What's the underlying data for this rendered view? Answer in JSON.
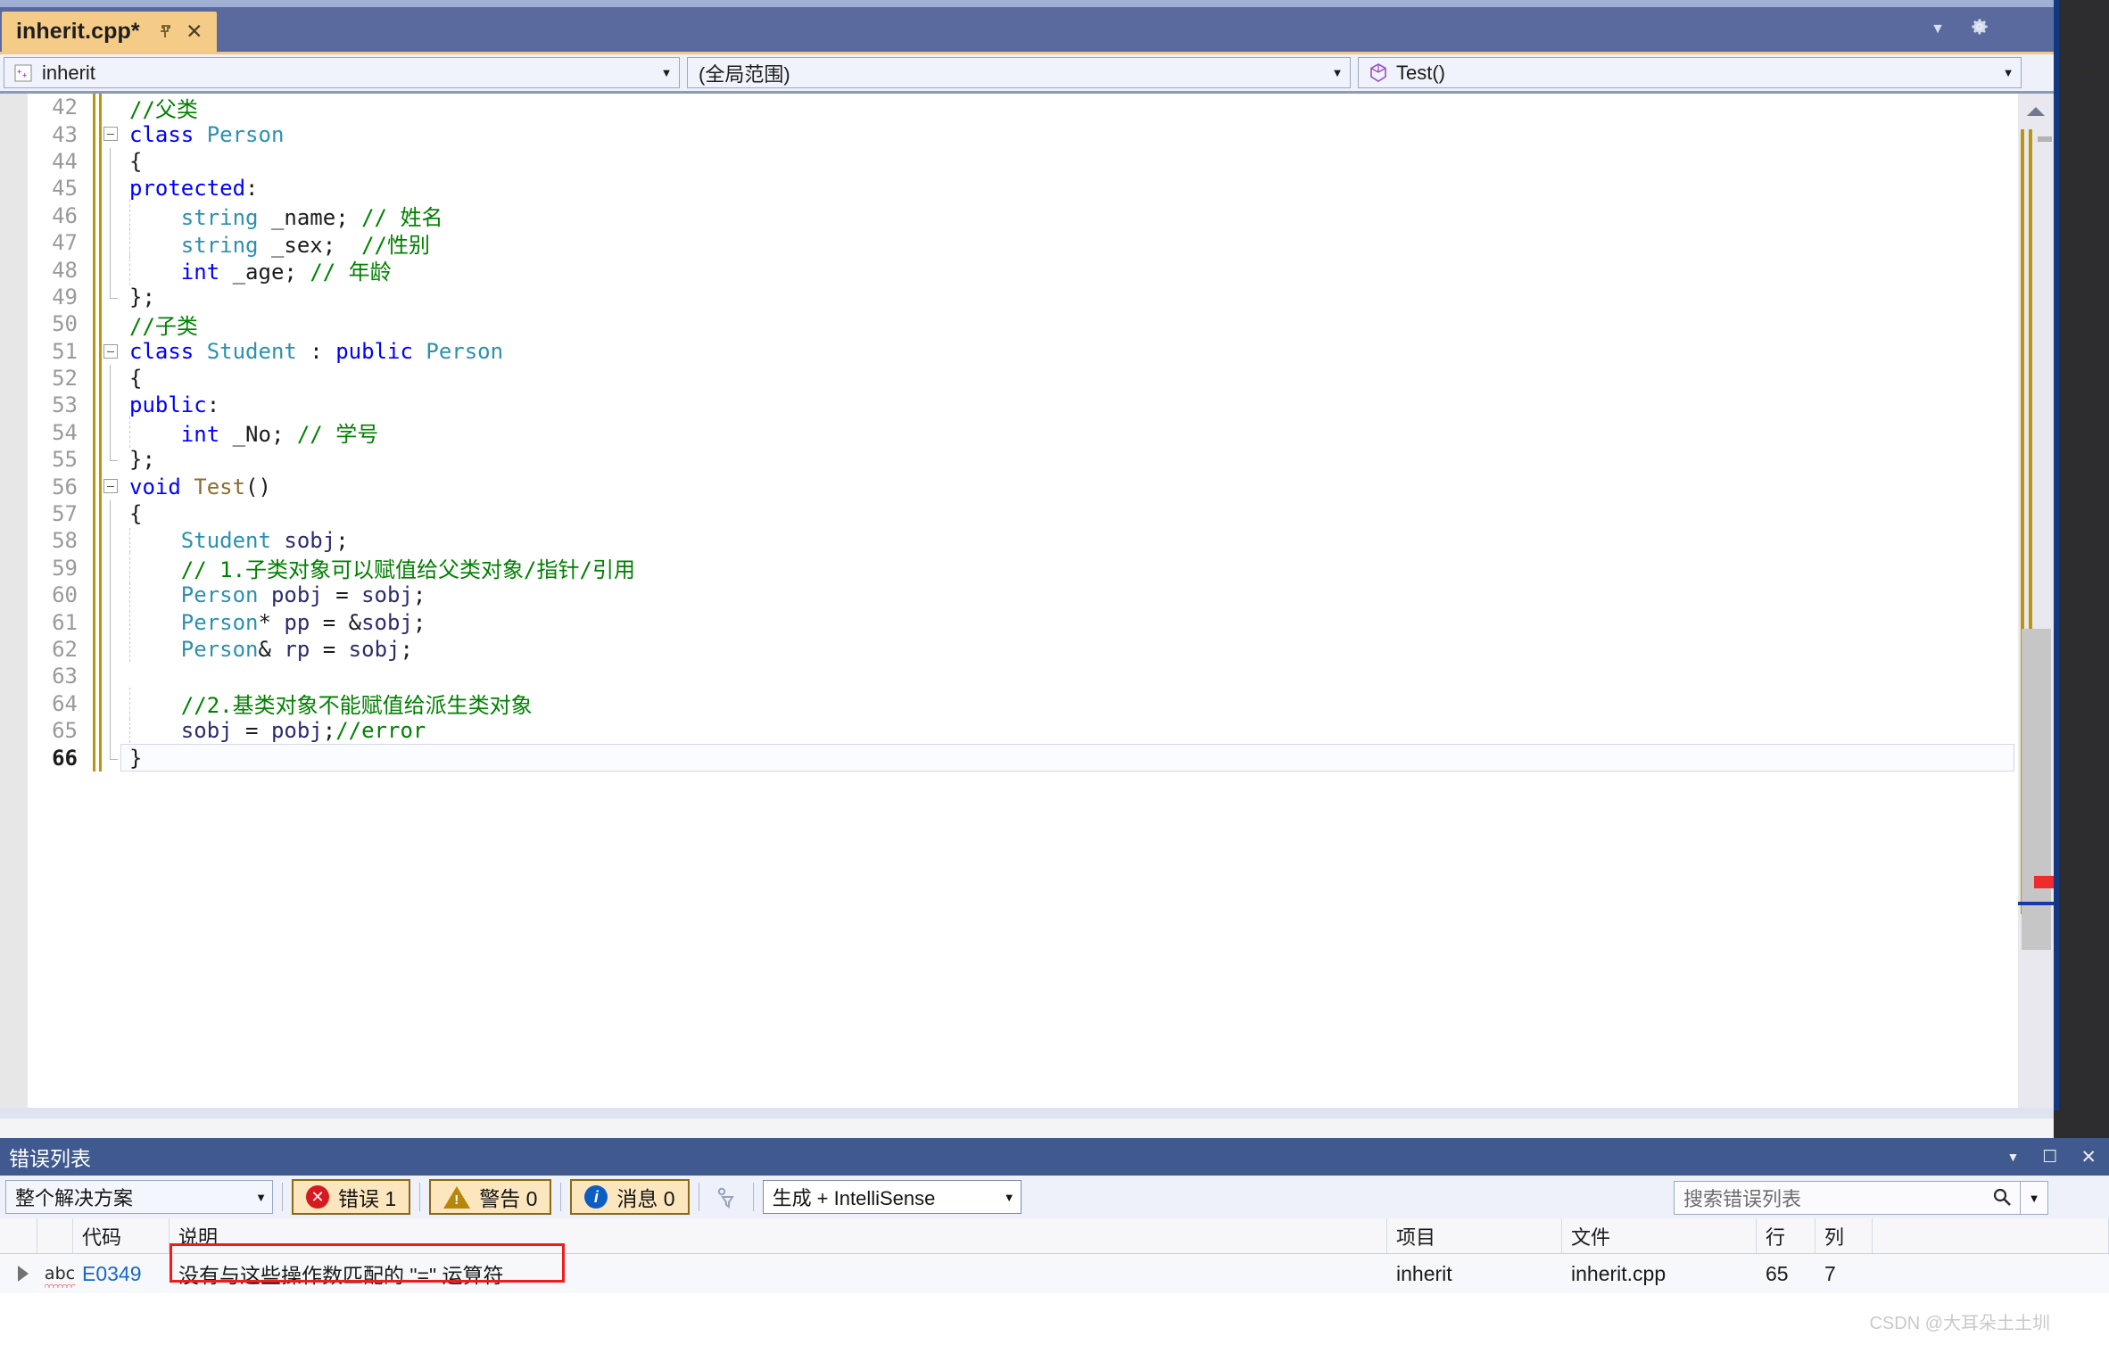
{
  "window": {
    "tab": {
      "label": "inherit.cpp*",
      "pin_icon": "pin-icon",
      "close_icon": "close-icon"
    },
    "tabbar_right": {
      "chevron_icon": "chevron-down-icon",
      "settings_icon": "gear-icon"
    }
  },
  "navbar": {
    "class_combo": {
      "icon": "cpp-file-icon",
      "value": "inherit",
      "caret": "▼"
    },
    "scope_combo": {
      "value": "(全局范围)",
      "caret": "▼"
    },
    "member_combo": {
      "icon": "method-cube-icon",
      "value": "Test()",
      "caret": "▼"
    },
    "split_icon": "split-window-icon"
  },
  "editor": {
    "first_visible_line": 42,
    "current_line": 66,
    "lines": [
      {
        "n": 42,
        "tokens": [
          {
            "t": "//父类",
            "c": "t-cmt"
          }
        ]
      },
      {
        "n": 43,
        "fold": "open",
        "tokens": [
          {
            "t": "class ",
            "c": "t-key"
          },
          {
            "t": "Person",
            "c": "t-type"
          }
        ]
      },
      {
        "n": 44,
        "tokens": [
          {
            "t": "{",
            "c": "t-pln"
          }
        ]
      },
      {
        "n": 45,
        "tokens": [
          {
            "t": "protected",
            "c": "t-key"
          },
          {
            "t": ":",
            "c": "t-pln"
          }
        ]
      },
      {
        "n": 46,
        "tokens": [
          {
            "t": "    ",
            "c": "t-pln"
          },
          {
            "t": "string",
            "c": "t-type"
          },
          {
            "t": " _name; ",
            "c": "t-pln"
          },
          {
            "t": "// 姓名",
            "c": "t-cmt"
          }
        ]
      },
      {
        "n": 47,
        "tokens": [
          {
            "t": "    ",
            "c": "t-pln"
          },
          {
            "t": "string",
            "c": "t-type"
          },
          {
            "t": " _sex;  ",
            "c": "t-pln"
          },
          {
            "t": "//性别",
            "c": "t-cmt"
          }
        ]
      },
      {
        "n": 48,
        "tokens": [
          {
            "t": "    ",
            "c": "t-pln"
          },
          {
            "t": "int",
            "c": "t-key"
          },
          {
            "t": " _age; ",
            "c": "t-pln"
          },
          {
            "t": "// 年龄",
            "c": "t-cmt"
          }
        ]
      },
      {
        "n": 49,
        "tokens": [
          {
            "t": "};",
            "c": "t-pln"
          }
        ]
      },
      {
        "n": 50,
        "tokens": [
          {
            "t": "//子类",
            "c": "t-cmt"
          }
        ]
      },
      {
        "n": 51,
        "fold": "open",
        "tokens": [
          {
            "t": "class ",
            "c": "t-key"
          },
          {
            "t": "Student",
            "c": "t-type"
          },
          {
            "t": " : ",
            "c": "t-pln"
          },
          {
            "t": "public",
            "c": "t-key"
          },
          {
            "t": " ",
            "c": "t-pln"
          },
          {
            "t": "Person",
            "c": "t-type"
          }
        ]
      },
      {
        "n": 52,
        "tokens": [
          {
            "t": "{",
            "c": "t-pln"
          }
        ]
      },
      {
        "n": 53,
        "tokens": [
          {
            "t": "public",
            "c": "t-key"
          },
          {
            "t": ":",
            "c": "t-pln"
          }
        ]
      },
      {
        "n": 54,
        "tokens": [
          {
            "t": "    ",
            "c": "t-pln"
          },
          {
            "t": "int",
            "c": "t-key"
          },
          {
            "t": " _No; ",
            "c": "t-pln"
          },
          {
            "t": "// 学号",
            "c": "t-cmt"
          }
        ]
      },
      {
        "n": 55,
        "tokens": [
          {
            "t": "};",
            "c": "t-pln"
          }
        ]
      },
      {
        "n": 56,
        "fold": "open",
        "tokens": [
          {
            "t": "void",
            "c": "t-key"
          },
          {
            "t": " ",
            "c": "t-pln"
          },
          {
            "t": "Test",
            "c": "t-fn"
          },
          {
            "t": "()",
            "c": "t-pln"
          }
        ]
      },
      {
        "n": 57,
        "tokens": [
          {
            "t": "{",
            "c": "t-pln"
          }
        ]
      },
      {
        "n": 58,
        "tokens": [
          {
            "t": "    ",
            "c": "t-pln"
          },
          {
            "t": "Student",
            "c": "t-type"
          },
          {
            "t": " ",
            "c": "t-pln"
          },
          {
            "t": "sobj",
            "c": "t-var"
          },
          {
            "t": ";",
            "c": "t-pln"
          }
        ]
      },
      {
        "n": 59,
        "tokens": [
          {
            "t": "    ",
            "c": "t-pln"
          },
          {
            "t": "// 1.子类对象可以赋值给父类对象/指针/引用",
            "c": "t-cmt"
          }
        ]
      },
      {
        "n": 60,
        "tokens": [
          {
            "t": "    ",
            "c": "t-pln"
          },
          {
            "t": "Person",
            "c": "t-type"
          },
          {
            "t": " ",
            "c": "t-pln"
          },
          {
            "t": "pobj",
            "c": "t-var"
          },
          {
            "t": " = ",
            "c": "t-pln"
          },
          {
            "t": "sobj",
            "c": "t-var"
          },
          {
            "t": ";",
            "c": "t-pln"
          }
        ]
      },
      {
        "n": 61,
        "tokens": [
          {
            "t": "    ",
            "c": "t-pln"
          },
          {
            "t": "Person",
            "c": "t-type"
          },
          {
            "t": "* ",
            "c": "t-pln"
          },
          {
            "t": "pp",
            "c": "t-var"
          },
          {
            "t": " = &",
            "c": "t-pln"
          },
          {
            "t": "sobj",
            "c": "t-var"
          },
          {
            "t": ";",
            "c": "t-pln"
          }
        ]
      },
      {
        "n": 62,
        "tokens": [
          {
            "t": "    ",
            "c": "t-pln"
          },
          {
            "t": "Person",
            "c": "t-type"
          },
          {
            "t": "& ",
            "c": "t-pln"
          },
          {
            "t": "rp",
            "c": "t-var"
          },
          {
            "t": " = ",
            "c": "t-pln"
          },
          {
            "t": "sobj",
            "c": "t-var"
          },
          {
            "t": ";",
            "c": "t-pln"
          }
        ]
      },
      {
        "n": 63,
        "tokens": [
          {
            "t": "",
            "c": "t-pln"
          }
        ]
      },
      {
        "n": 64,
        "tokens": [
          {
            "t": "    ",
            "c": "t-pln"
          },
          {
            "t": "//2.基类对象不能赋值给派生类对象",
            "c": "t-cmt"
          }
        ]
      },
      {
        "n": 65,
        "tokens": [
          {
            "t": "    ",
            "c": "t-pln"
          },
          {
            "t": "sobj",
            "c": "t-var"
          },
          {
            "t": " ",
            "c": "t-pln"
          },
          {
            "t": "=",
            "c": "t-pln",
            "sq": true
          },
          {
            "t": " ",
            "c": "t-pln"
          },
          {
            "t": "pobj",
            "c": "t-var"
          },
          {
            "t": ";",
            "c": "t-pln"
          },
          {
            "t": "//error",
            "c": "t-cmt"
          }
        ]
      },
      {
        "n": 66,
        "current": true,
        "tokens": [
          {
            "t": "}",
            "c": "t-pln"
          }
        ]
      }
    ],
    "scrollbar": {
      "up_arrow_icon": "scroll-up-arrow-icon",
      "error_marker": "error-marker",
      "caret_marker": "caret-position-marker"
    }
  },
  "error_panel": {
    "title": "错误列表",
    "window_buttons": {
      "dropdown_icon": "window-dropdown-icon",
      "float_icon": "window-float-icon",
      "close_icon": "window-close-icon"
    },
    "toolbar": {
      "scope_filter": {
        "value": "整个解决方案",
        "caret": "▼"
      },
      "errors_pill": {
        "icon": "error-circle-icon",
        "label": "错误 1"
      },
      "warnings_pill": {
        "icon": "warning-triangle-icon",
        "label": "警告 0"
      },
      "messages_pill": {
        "icon": "info-circle-icon",
        "label": "消息 0"
      },
      "filter_icon": "filter-funnel-icon",
      "build_filter": {
        "value": "生成 + IntelliSense",
        "caret": "▼"
      },
      "search": {
        "placeholder": "搜索错误列表",
        "magnifier_icon": "search-icon",
        "caret": "▼"
      }
    },
    "columns": [
      "",
      "",
      "代码",
      "说明",
      "项目",
      "文件",
      "行",
      "列"
    ],
    "rows": [
      {
        "expander": "expand-triangle-icon",
        "severity_icon": "intellisense-squiggle-icon",
        "code": "E0349",
        "description": "没有与这些操作数匹配的 \"=\" 运算符",
        "project": "inherit",
        "file": "inherit.cpp",
        "line": "65",
        "column": "7",
        "highlighted": true
      }
    ]
  },
  "watermark": {
    "text": "CSDN @大耳朵土土圳"
  },
  "colors": {
    "accent_tab": "#f5cb88",
    "chrome_blue": "#5b6a9e",
    "panel_title_blue": "#40598e",
    "error_red": "#d71920",
    "keyword_blue": "#0000ff",
    "type_teal": "#2b91af",
    "comment_green": "#008000",
    "changebar_gold": "#b8960f"
  }
}
